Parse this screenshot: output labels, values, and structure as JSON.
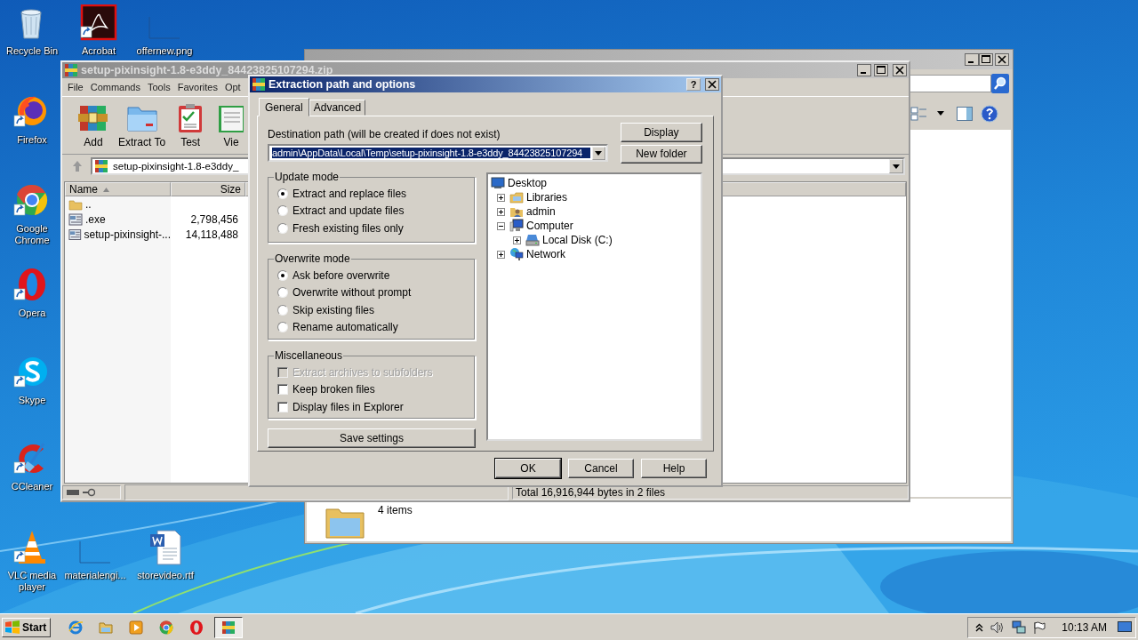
{
  "desktop": {
    "icons": [
      {
        "label": "Recycle Bin",
        "kind": "recycle",
        "shortcut": false
      },
      {
        "label": "Acrobat",
        "kind": "acrobat",
        "shortcut": true
      },
      {
        "label": "offernew.png",
        "kind": "blank",
        "shortcut": false
      },
      {
        "label": "Firefox",
        "kind": "firefox",
        "shortcut": true
      },
      {
        "label": "Google Chrome",
        "kind": "chrome",
        "shortcut": true
      },
      {
        "label": "Opera",
        "kind": "opera",
        "shortcut": true
      },
      {
        "label": "Skype",
        "kind": "skype",
        "shortcut": true
      },
      {
        "label": "CCleaner",
        "kind": "ccleaner",
        "shortcut": true
      },
      {
        "label": "VLC media player",
        "kind": "vlc",
        "shortcut": true
      },
      {
        "label": "materialengi...",
        "kind": "blank",
        "shortcut": false
      },
      {
        "label": "storevideo.rtf",
        "kind": "word",
        "shortcut": false
      }
    ]
  },
  "explorer_window": {
    "details": "4 items"
  },
  "archive_window": {
    "title": "setup-pixinsight-1.8-e3ddy_84423825107294.zip",
    "menu": [
      "File",
      "Commands",
      "Tools",
      "Favorites",
      "Opt"
    ],
    "toolbar": [
      {
        "label": "Add",
        "kind": "add"
      },
      {
        "label": "Extract To",
        "kind": "extract"
      },
      {
        "label": "Test",
        "kind": "test"
      },
      {
        "label": "Vie",
        "kind": "view"
      }
    ],
    "address": "setup-pixinsight-1.8-e3ddy_",
    "columns": [
      "Name",
      "Size"
    ],
    "rows": [
      {
        "name": "..",
        "kind": "folder"
      },
      {
        "name": ".exe",
        "size": "2,798,456",
        "kind": "file"
      },
      {
        "name": "setup-pixinsight-...",
        "size": "14,118,488",
        "kind": "file"
      }
    ],
    "status": "Total 16,916,944 bytes in 2 files"
  },
  "dialog": {
    "title": "Extraction path and options",
    "help": "?",
    "tabs": [
      {
        "label": "General",
        "selected": true
      },
      {
        "label": "Advanced",
        "selected": false
      }
    ],
    "path_label": "Destination path (will be created if does not exist)",
    "path": "admin\\AppData\\Local\\Temp\\setup-pixinsight-1.8-e3ddy_84423825107294",
    "side_buttons": [
      "Display",
      "New folder"
    ],
    "groups": [
      {
        "title": "Update mode",
        "kind": "radio",
        "options": [
          {
            "label": "Extract and replace files",
            "selected": true
          },
          {
            "label": "Extract and update files",
            "selected": false
          },
          {
            "label": "Fresh existing files only",
            "selected": false
          }
        ]
      },
      {
        "title": "Overwrite mode",
        "kind": "radio",
        "options": [
          {
            "label": "Ask before overwrite",
            "selected": true
          },
          {
            "label": "Overwrite without prompt",
            "selected": false
          },
          {
            "label": "Skip existing files",
            "selected": false
          },
          {
            "label": "Rename automatically",
            "selected": false
          }
        ]
      },
      {
        "title": "Miscellaneous",
        "kind": "checkbox",
        "options": [
          {
            "label": "Extract archives to subfolders",
            "checked": false,
            "disabled": true
          },
          {
            "label": "Keep broken files",
            "checked": false,
            "disabled": false
          },
          {
            "label": "Display files in Explorer",
            "checked": false,
            "disabled": false
          }
        ]
      }
    ],
    "save_button": "Save settings",
    "tree": [
      {
        "label": "Desktop",
        "kind": "desktop",
        "children": [
          {
            "label": "Libraries",
            "kind": "libraries",
            "expanded": false
          },
          {
            "label": "admin",
            "kind": "user",
            "expanded": false
          },
          {
            "label": "Computer",
            "kind": "computer",
            "expanded": true,
            "children": [
              {
                "label": "Local Disk (C:)",
                "kind": "disk",
                "expanded": false
              }
            ]
          },
          {
            "label": "Network",
            "kind": "network",
            "expanded": false
          }
        ]
      }
    ],
    "buttons": [
      {
        "label": "OK",
        "default": true
      },
      {
        "label": "Cancel",
        "default": false
      },
      {
        "label": "Help",
        "default": false
      }
    ]
  },
  "taskbar": {
    "start": "Start",
    "apps": [
      {
        "kind": "ie",
        "active": false
      },
      {
        "kind": "folder",
        "active": false
      },
      {
        "kind": "media",
        "active": false
      },
      {
        "kind": "chrome",
        "active": false
      },
      {
        "kind": "opera",
        "active": false
      },
      {
        "kind": "winrar",
        "active": true
      }
    ],
    "clock": "10:13 AM"
  }
}
